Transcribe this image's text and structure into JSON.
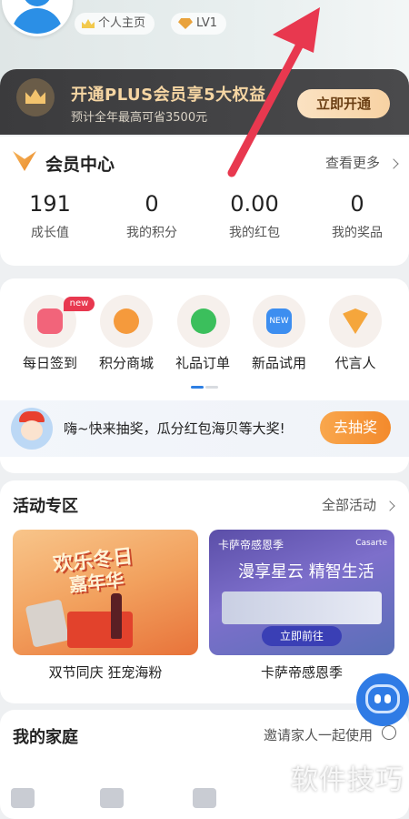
{
  "header": {
    "homepage_label": "个人主页",
    "level_label": "LV1"
  },
  "plus_banner": {
    "title": "开通PLUS会员享5大权益",
    "subtitle": "预计全年最高可省3500元",
    "button": "立即开通"
  },
  "member_center": {
    "title": "会员中心",
    "more": "查看更多",
    "stats": [
      {
        "value": "191",
        "label": "成长值"
      },
      {
        "value": "0",
        "label": "我的积分"
      },
      {
        "value": "0.00",
        "label": "我的红包"
      },
      {
        "value": "0",
        "label": "我的奖品"
      }
    ]
  },
  "quick_menu": {
    "badge": "new",
    "items": [
      {
        "label": "每日签到",
        "icon": "calendar-icon",
        "color": "#f2647a"
      },
      {
        "label": "积分商城",
        "icon": "shop-icon",
        "color": "#f59a3c"
      },
      {
        "label": "礼品订单",
        "icon": "gift-icon",
        "color": "#3bbf5c"
      },
      {
        "label": "新品试用",
        "icon": "new-tag-icon",
        "color": "#3d8ef0"
      },
      {
        "label": "代言人",
        "icon": "heart-icon",
        "color": "#f5a63c"
      }
    ],
    "new_icon_text": "NEW"
  },
  "lottery": {
    "text": "嗨~快来抽奖，瓜分红包海贝等大奖!",
    "button": "去抽奖"
  },
  "activity": {
    "title": "活动专区",
    "more": "全部活动",
    "banners": [
      {
        "line1": "欢乐冬日",
        "line2": "嘉年华",
        "caption": "双节同庆 狂宠海粉"
      },
      {
        "brand": "卡萨帝感恩季",
        "brand_right": "Casarte",
        "title": "漫享星云 精智生活",
        "button": "立即前往",
        "caption": "卡萨帝感恩季"
      }
    ]
  },
  "family": {
    "title": "我的家庭",
    "invite": "邀请家人一起使用"
  },
  "watermark": "软件技巧",
  "colors": {
    "accent": "#2d7fe3",
    "arrow": "#e8384f"
  }
}
